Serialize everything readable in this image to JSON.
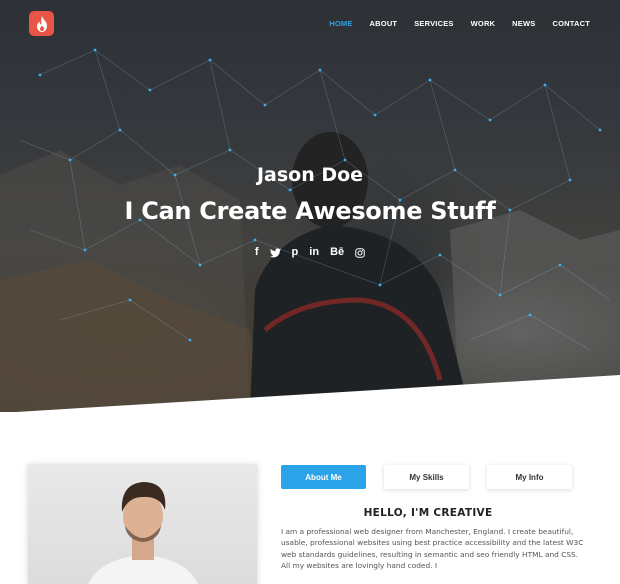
{
  "brand": {
    "logo_icon": "flame-icon",
    "accent": "#2ba3e8",
    "logo_color": "#e85445"
  },
  "nav": {
    "items": [
      {
        "label": "HOME",
        "active": true
      },
      {
        "label": "ABOUT",
        "active": false
      },
      {
        "label": "SERVICES",
        "active": false
      },
      {
        "label": "WORK",
        "active": false
      },
      {
        "label": "NEWS",
        "active": false
      },
      {
        "label": "CONTACT",
        "active": false
      }
    ]
  },
  "hero": {
    "name": "Jason Doe",
    "tagline": "I Can Create Awesome Stuff",
    "socials": [
      {
        "icon": "facebook-icon",
        "glyph": "f"
      },
      {
        "icon": "twitter-icon",
        "glyph": "𝕥"
      },
      {
        "icon": "pinterest-icon",
        "glyph": "p"
      },
      {
        "icon": "linkedin-icon",
        "glyph": "in"
      },
      {
        "icon": "behance-icon",
        "glyph": "Bē"
      },
      {
        "icon": "instagram-icon",
        "glyph": "◎"
      }
    ]
  },
  "about": {
    "tabs": [
      {
        "label": "About Me",
        "active": true
      },
      {
        "label": "My Skills",
        "active": false
      },
      {
        "label": "My Info",
        "active": false
      }
    ],
    "heading": "HELLO, I'M CREATIVE",
    "body": "I am a professional web designer from Manchester, England. I create beautiful, usable, professional websites using best practice accessibility and the latest W3C web standards guidelines, resulting in semantic and seo friendly HTML and CSS. All my websites are lovingly hand coded. I"
  }
}
